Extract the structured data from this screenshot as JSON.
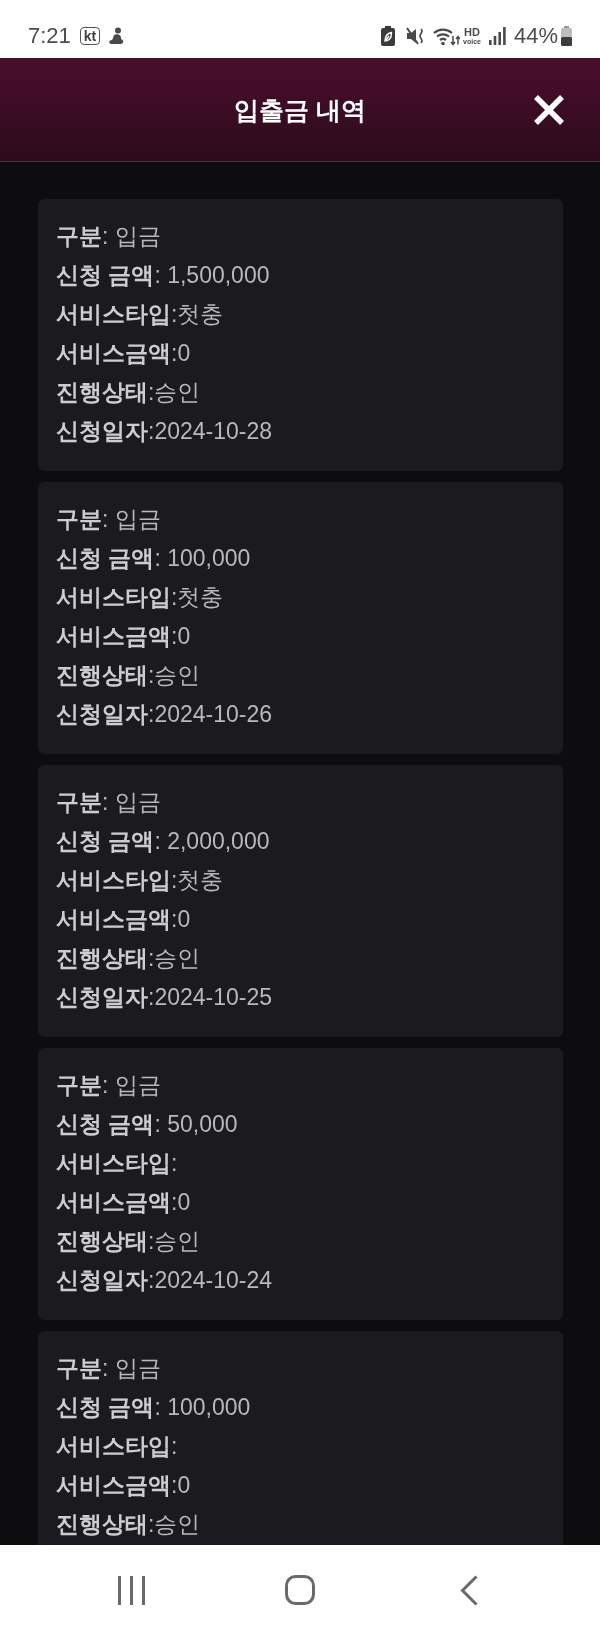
{
  "status_bar": {
    "time": "7:21",
    "carrier": "kt",
    "hd_voice": [
      "HD",
      "voice"
    ],
    "battery": "44%"
  },
  "header": {
    "title": "입출금 내역"
  },
  "records": [
    {
      "lines": [
        "**구분**: 입금",
        "**신청 금액**: 1,500,000",
        "**서비스타입**:첫충",
        "**서비스금액**:0",
        "**진행상태**:승인",
        "**신청일자**:2024-10-28"
      ]
    },
    {
      "lines": [
        "**구분**: 입금",
        "**신청 금액**: 100,000",
        "**서비스타입**:첫충",
        "**서비스금액**:0",
        "**진행상태**:승인",
        "**신청일자**:2024-10-26"
      ]
    },
    {
      "lines": [
        "**구분**: 입금",
        "**신청 금액**: 2,000,000",
        "**서비스타입**:첫충",
        "**서비스금액**:0",
        "**진행상태**:승인",
        "**신청일자**:2024-10-25"
      ]
    },
    {
      "lines": [
        "**구분**: 입금",
        "**신청 금액**: 50,000",
        "**서비스타입**:",
        "**서비스금액**:0",
        "**진행상태**:승인",
        "**신청일자**:2024-10-24"
      ]
    },
    {
      "lines": [
        "**구분**: 입금",
        "**신청 금액**: 100,000",
        "**서비스타입**:",
        "**서비스금액**:0",
        "**진행상태**:승인"
      ]
    }
  ]
}
